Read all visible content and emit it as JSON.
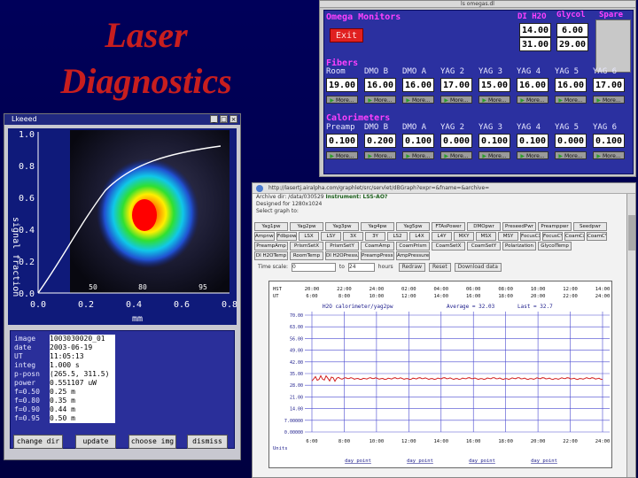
{
  "slide": {
    "title_line1": "Laser",
    "title_line2": "Diagnostics"
  },
  "omega": {
    "window_title": "ls omegas.dl",
    "heading": "Omega Monitors",
    "exit_label": "Exit",
    "col_di_h2o": "DI H2O",
    "col_glycol": "Glycol",
    "col_spare": "Spare",
    "di_values": [
      "14.00",
      "31.00"
    ],
    "glycol_values": [
      "6.00",
      "29.00"
    ],
    "fibers_label": "Fibers",
    "fiber_headers": [
      "Room",
      "DMO B",
      "DMO A",
      "YAG 2",
      "YAG 3",
      "YAG 4",
      "YAG 5",
      "YAG 6"
    ],
    "fiber_values": [
      "19.00",
      "16.00",
      "16.00",
      "17.00",
      "15.00",
      "16.00",
      "16.00",
      "17.00"
    ],
    "more_label": "More...",
    "calorimeters_label": "Calorimeters",
    "cal_headers": [
      "Preamp",
      "DMO B",
      "DMO A",
      "YAG 2",
      "YAG 3",
      "YAG 4",
      "YAG 5",
      "YAG 6"
    ],
    "cal_values": [
      "0.100",
      "0.200",
      "0.100",
      "0.000",
      "0.100",
      "0.100",
      "0.000",
      "0.100"
    ]
  },
  "profile": {
    "window_title": "Lkeeed",
    "win_buttons": [
      "_",
      "□",
      "×"
    ],
    "y_label": "signal fraction",
    "y_ticks": [
      "1.0",
      "0.8",
      "0.6",
      "0.4",
      "0.2",
      "0.0"
    ],
    "x_ticks": [
      "0.0",
      "0.2",
      "0.4",
      "0.6",
      "0.8"
    ],
    "x_label": "mm",
    "contour_labels": [
      "50",
      "80",
      "95"
    ],
    "info_keys": [
      "image",
      "date",
      "UT",
      "integ",
      "p-posn",
      "power",
      "f=0.50",
      "f=0.80",
      "f=0.90",
      "f=0.95"
    ],
    "info_values": [
      "1003030020_01",
      "2003-06-19",
      "11:05:13",
      "1.000 s",
      "(265.5, 311.5)",
      "0.551107 uW",
      "0.25 m",
      "0.35 m",
      "0.44 m",
      "0.50 m"
    ],
    "buttons": [
      "change dir",
      "update",
      "choose img",
      "dismiss"
    ]
  },
  "browser": {
    "url": "http://lasertj.airalpha.com/graphlet/src/servlet/dBGraph?expr=&fname=&archive=",
    "archive_line": "Archive dir: /data/030529",
    "instrument_label": "Instrument:",
    "instrument_value": "LSS-AO?",
    "designed_for": "Designed for 1280x1024",
    "select_graph": "Select graph to:",
    "button_rows": [
      [
        "Yag1pw",
        "Yag2pw",
        "Yag3pw",
        "Yag4pw",
        "Yag5pw",
        "FTAsPower",
        "DMOpwr",
        "PreseedPwr",
        "Preamppwr",
        "Seedpwr"
      ],
      [
        "Ampnwr",
        "Fdbpower",
        "LSX",
        "LSY",
        "3X",
        "3Y",
        "LS2",
        "L4X",
        "L4Y",
        "MXY",
        "MSX",
        "MSY",
        "FocusCX",
        "FocusCY",
        "CoamCx",
        "CoamCY"
      ],
      [
        "PreampAmp",
        "PrismSetX",
        "PrismSetY",
        "CoamAmp",
        "CoamPrism",
        "CoamSetX",
        "CoamSetY",
        "Polarization",
        "GlycolTemp"
      ],
      [
        "DI H2OTemp",
        "RoomTemp",
        "DI H2OPressure",
        "PreampPressure",
        "AmpPressure"
      ]
    ],
    "time_label": "Time scale:",
    "time_from": "0",
    "time_to_label": "to",
    "time_to": "24",
    "time_unit": "hours",
    "redraw": "Redraw",
    "reset": "Reset",
    "download": "Download data",
    "chart_hst_label": "HST",
    "chart_ut_label": "UT",
    "chart_hst_ticks": [
      "20:00",
      "22:00",
      "24:00",
      "02:00",
      "04:00",
      "06:00",
      "08:00",
      "10:00",
      "12:00",
      "14:00"
    ],
    "chart_ut_ticks": [
      "6:00",
      "8:00",
      "10:00",
      "12:00",
      "14:00",
      "16:00",
      "18:00",
      "20:00",
      "22:00",
      "24:00"
    ],
    "chart_bottom_ticks": [
      "6:00",
      "8:00",
      "10:00",
      "12:00",
      "14:00",
      "16:00",
      "18:00",
      "20:00",
      "22:00",
      "24:00"
    ],
    "chart_series_title": "H2O calorimeter/yag2pw",
    "chart_average": "Average = 32.03",
    "chart_last": "Last = 32.7",
    "units_label": "Units",
    "bottom_links": [
      "day point",
      "day point",
      "day point",
      "day point"
    ]
  },
  "chart_data": {
    "type": "line",
    "series": [
      {
        "name": "H2O calorimeter/yag2pw",
        "approx_level": 32.0,
        "color": "#d22020"
      }
    ],
    "y_ticks": [
      "70.00",
      "63.00",
      "56.00",
      "49.00",
      "42.00",
      "35.00",
      "28.00",
      "21.00",
      "14.00",
      "7.00000",
      "0.00000"
    ],
    "ylim": [
      0,
      70
    ],
    "grid": true
  },
  "colors": {
    "slide_bg": "#000055",
    "title_red": "#c81e1e",
    "panel_blue": "#2b30a0",
    "label_magenta": "#ff40ff"
  }
}
